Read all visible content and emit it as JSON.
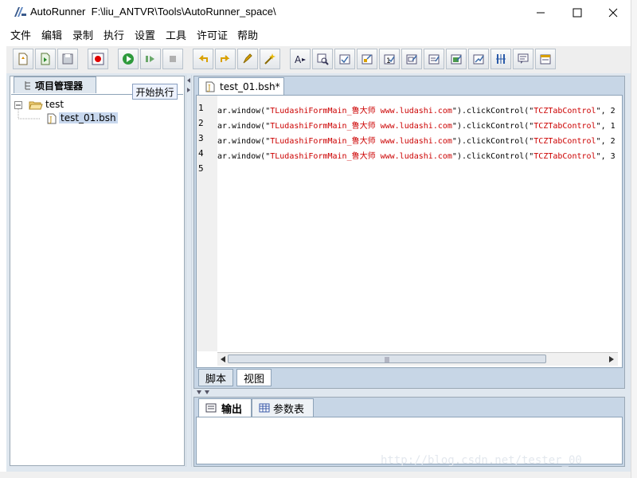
{
  "window": {
    "app_name": "AutoRunner",
    "path": "F:\\liu_ANTVR\\Tools\\AutoRunner_space\\",
    "controls": {
      "minimize": "—",
      "maximize": "☐",
      "close": "✕"
    }
  },
  "menu": [
    "文件",
    "编辑",
    "录制",
    "执行",
    "设置",
    "工具",
    "许可证",
    "帮助"
  ],
  "toolbar": {
    "tooltip": "开始执行",
    "buttons": [
      "new-file",
      "import",
      "save",
      "record",
      "run",
      "step-run",
      "stop",
      "undo",
      "redo",
      "script-tool-1",
      "script-tool-2",
      "text-tool",
      "find-tool",
      "checkpoint-1",
      "checkpoint-2",
      "checkpoint-3",
      "checkpoint-4",
      "checkpoint-5",
      "checkpoint-6",
      "checkpoint-7",
      "split-tool",
      "comment-tool",
      "property-tool"
    ]
  },
  "project_panel": {
    "tab_label": "项目管理器",
    "tree": {
      "root": "test",
      "children": [
        "test_01.bsh"
      ]
    }
  },
  "editor": {
    "file_tab": "test_01.bsh*",
    "line_numbers": [
      "1",
      "2",
      "3",
      "4",
      "5"
    ],
    "lines": [
      {
        "prefix": "ar.window(\"",
        "s1": "TLudashiFormMain_鲁大师 www.ludashi.com",
        "mid": "\").clickControl(\"",
        "s2": "TCZTabControl",
        "suffix": "\", 2"
      },
      {
        "prefix": "ar.window(\"",
        "s1": "TLudashiFormMain_鲁大师 www.ludashi.com",
        "mid": "\").clickControl(\"",
        "s2": "TCZTabControl",
        "suffix": "\", 1"
      },
      {
        "prefix": "ar.window(\"",
        "s1": "TLudashiFormMain_鲁大师 www.ludashi.com",
        "mid": "\").clickControl(\"",
        "s2": "TCZTabControl",
        "suffix": "\", 2"
      },
      {
        "prefix": "ar.window(\"",
        "s1": "TLudashiFormMain_鲁大师 www.ludashi.com",
        "mid": "\").clickControl(\"",
        "s2": "TCZTabControl",
        "suffix": "\", 3"
      }
    ],
    "bottom_tabs": {
      "script": "脚本",
      "view": "视图"
    }
  },
  "output_panel": {
    "tab_output": "输出",
    "tab_params": "参数表"
  },
  "watermark": "http://blog.csdn.net/tester_00",
  "colors": {
    "panel_bg": "#dfe7ef",
    "string": "#cc0000",
    "tab_border": "#8ea3b8"
  }
}
